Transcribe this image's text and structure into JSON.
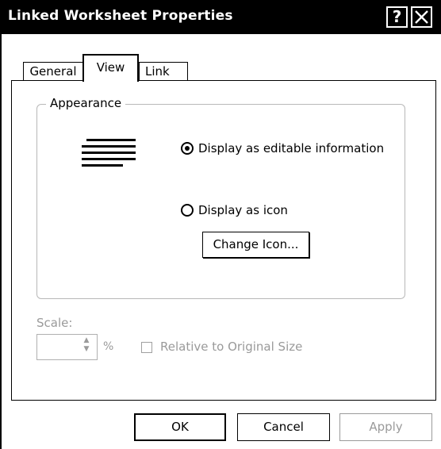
{
  "window": {
    "title": "Linked Worksheet Properties",
    "help_label": "?"
  },
  "tabs": [
    {
      "label": "General",
      "selected": false
    },
    {
      "label": "View",
      "selected": true
    },
    {
      "label": "Link",
      "selected": false
    }
  ],
  "appearance": {
    "group_label": "Appearance",
    "option_editable": {
      "label": "Display as editable information",
      "checked": true
    },
    "option_icon": {
      "label": "Display as icon",
      "checked": false
    },
    "change_icon_label": "Change Icon..."
  },
  "scale": {
    "label": "Scale:",
    "value": "",
    "unit": "%",
    "relative_label": "Relative to Original Size",
    "relative_checked": false
  },
  "buttons": {
    "ok": "OK",
    "cancel": "Cancel",
    "apply": "Apply"
  }
}
